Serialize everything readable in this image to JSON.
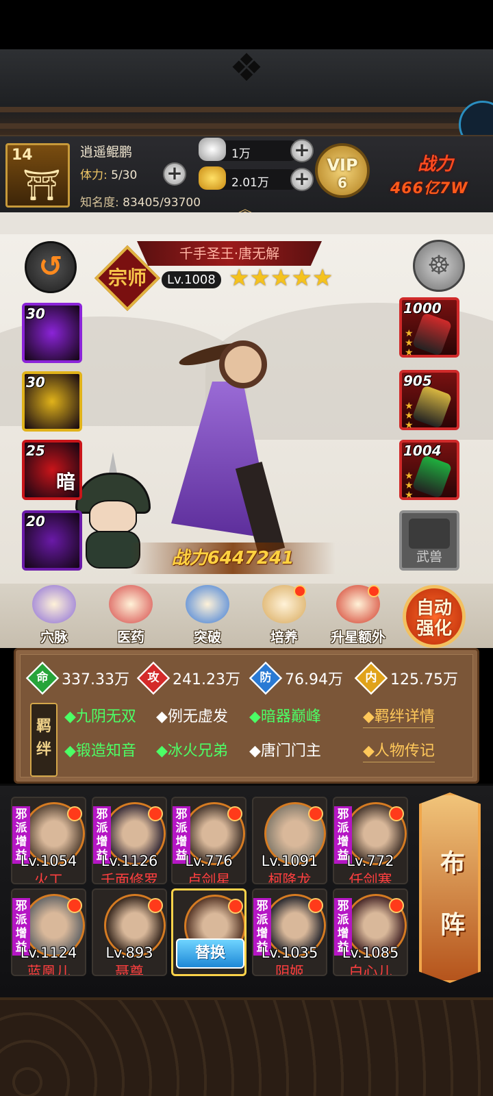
{
  "player": {
    "level": "14",
    "name": "逍遥鲲鹏",
    "stamina_label": "体力:",
    "stamina_value": "5/30",
    "fame_label": "知名度:",
    "fame_value": "83405/93700"
  },
  "resources": {
    "silver": "1万",
    "gold": "2.01万"
  },
  "vip": {
    "label": "VIP",
    "level": "6"
  },
  "top_power": {
    "label": "战力",
    "value": "466亿7W"
  },
  "hero": {
    "title": "千手圣王·唐无解",
    "rank_badge": "宗师",
    "level": "Lv.1008",
    "stars": "★★★★★",
    "star_count": 5,
    "power": "战力6447241"
  },
  "skills": [
    {
      "level": "30",
      "glyph": "",
      "color": "#8b24d8"
    },
    {
      "level": "30",
      "glyph": "",
      "color": "#e1b31a"
    },
    {
      "level": "25",
      "glyph": "暗",
      "color": "#c9151a"
    },
    {
      "level": "20",
      "glyph": "",
      "color": "#6a1aa8"
    }
  ],
  "equipment": [
    {
      "level": "1000",
      "gem_color": "#d02a2a"
    },
    {
      "level": "905",
      "gem_color": "#d8b640"
    },
    {
      "level": "1004",
      "gem_color": "#1fae3e"
    }
  ],
  "beast_slot": {
    "label": "武兽"
  },
  "functions": [
    {
      "label": "穴脉",
      "icon": "meridian-icon",
      "color": "#8a6cd8",
      "badge": false
    },
    {
      "label": "医药",
      "icon": "medicine-icon",
      "color": "#d54848",
      "badge": false
    },
    {
      "label": "突破",
      "icon": "breakthrough-icon",
      "color": "#3a7ad8",
      "badge": false
    },
    {
      "label": "培养",
      "icon": "train-scroll-icon",
      "color": "#d7a85a",
      "badge": true
    },
    {
      "label": "升星额外",
      "icon": "star-up-icon",
      "color": "#d23a2a",
      "badge": true
    }
  ],
  "auto_button": {
    "line1": "自动",
    "line2": "强化"
  },
  "attributes": [
    {
      "label": "命",
      "value": "337.33万",
      "color": "#26a43a"
    },
    {
      "label": "攻",
      "value": "241.23万",
      "color": "#d42a2a"
    },
    {
      "label": "防",
      "value": "76.94万",
      "color": "#2a7ad4"
    },
    {
      "label": "内",
      "value": "125.75万",
      "color": "#e0a21a"
    }
  ],
  "bonds": {
    "badge": "羁绊",
    "row1": [
      {
        "text": "◆九阴无双",
        "active": true
      },
      {
        "text": "◆例无虚发",
        "active": false
      },
      {
        "text": "◆暗器巅峰",
        "active": true
      }
    ],
    "row2": [
      {
        "text": "◆锻造知音",
        "active": true
      },
      {
        "text": "◆冰火兄弟",
        "active": true
      },
      {
        "text": "◆唐门门主",
        "active": false
      }
    ],
    "link_details": "◆羁绊详情",
    "link_bio": "◆人物传记"
  },
  "team": [
    {
      "tag": "邪派增益",
      "level": "Lv.1054",
      "name": "火工"
    },
    {
      "tag": "邪派增益",
      "level": "Lv.1126",
      "name": "千面修罗"
    },
    {
      "tag": "邪派增益",
      "level": "Lv.776",
      "name": "卢剑星"
    },
    {
      "tag": "",
      "level": "Lv.1091",
      "name": "柯降龙"
    },
    {
      "tag": "邪派增益",
      "level": "Lv.772",
      "name": "任剑寒"
    },
    {
      "tag": "邪派增益",
      "level": "Lv.1124",
      "name": "蓝凰儿"
    },
    {
      "tag": "",
      "level": "Lv.893",
      "name": "聂尊"
    },
    {
      "tag": "",
      "level": "",
      "name": "",
      "swap_label": "替换"
    },
    {
      "tag": "邪派增益",
      "level": "Lv.1035",
      "name": "阴姬"
    },
    {
      "tag": "邪派增益",
      "level": "Lv.1085",
      "name": "白心儿"
    }
  ],
  "formation_button": {
    "line1": "布",
    "line2": "阵"
  }
}
